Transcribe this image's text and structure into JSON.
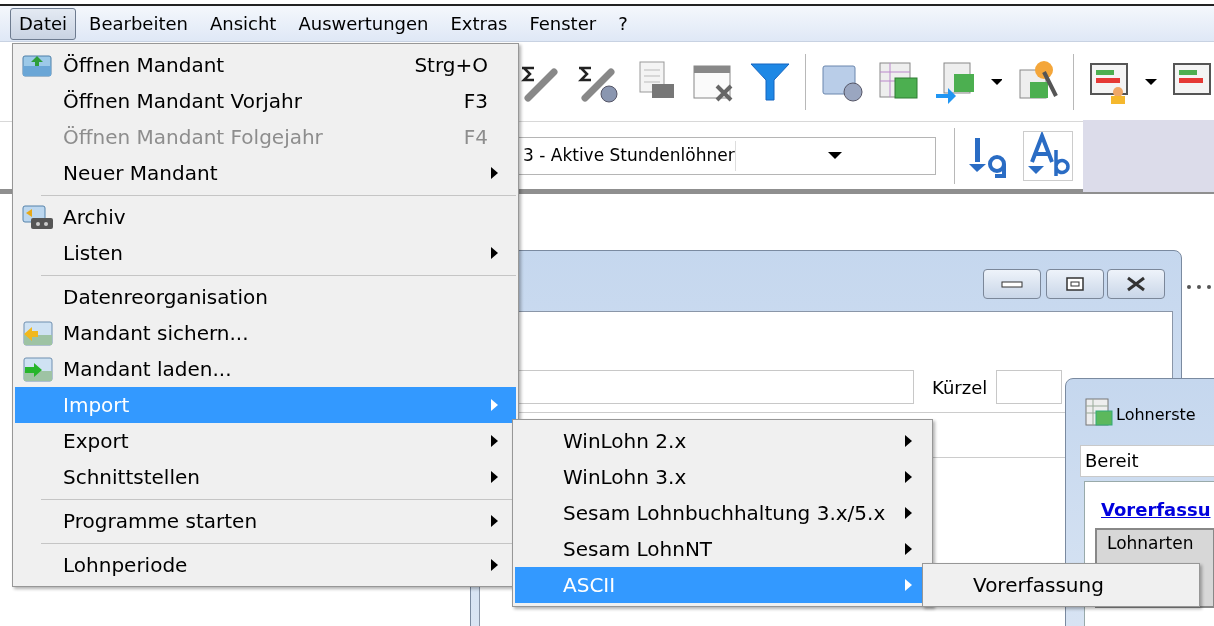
{
  "menubar": [
    {
      "label": "Datei",
      "selected": true
    },
    {
      "label": "Bearbeiten",
      "selected": false
    },
    {
      "label": "Ansicht",
      "selected": false
    },
    {
      "label": "Auswertungen",
      "selected": false
    },
    {
      "label": "Extras",
      "selected": false
    },
    {
      "label": "Fenster",
      "selected": false
    },
    {
      "label": "?",
      "selected": false
    }
  ],
  "file_menu": [
    {
      "kind": "item",
      "label": "Öffnen Mandant",
      "shortcut": "Strg+O",
      "disabled": false,
      "submenu": false,
      "selected": false
    },
    {
      "kind": "item",
      "label": "Öffnen Mandant Vorjahr",
      "shortcut": "F3",
      "disabled": false,
      "submenu": false,
      "selected": false
    },
    {
      "kind": "item",
      "label": "Öffnen Mandant Folgejahr",
      "shortcut": "F4",
      "disabled": true,
      "submenu": false,
      "selected": false
    },
    {
      "kind": "item",
      "label": "Neuer Mandant",
      "disabled": false,
      "submenu": true,
      "selected": false
    },
    {
      "kind": "separator"
    },
    {
      "kind": "item",
      "label": "Archiv",
      "disabled": false,
      "submenu": false,
      "selected": false
    },
    {
      "kind": "item",
      "label": "Listen",
      "disabled": false,
      "submenu": true,
      "selected": false
    },
    {
      "kind": "separator"
    },
    {
      "kind": "item",
      "label": "Datenreorganisation",
      "disabled": false,
      "submenu": false,
      "selected": false
    },
    {
      "kind": "item",
      "label": "Mandant sichern...",
      "disabled": false,
      "submenu": false,
      "selected": false
    },
    {
      "kind": "item",
      "label": "Mandant laden...",
      "disabled": false,
      "submenu": false,
      "selected": false
    },
    {
      "kind": "item",
      "label": "Import",
      "disabled": false,
      "submenu": true,
      "selected": true
    },
    {
      "kind": "item",
      "label": "Export",
      "disabled": false,
      "submenu": true,
      "selected": false
    },
    {
      "kind": "item",
      "label": "Schnittstellen",
      "disabled": false,
      "submenu": true,
      "selected": false
    },
    {
      "kind": "separator"
    },
    {
      "kind": "item",
      "label": "Programme starten",
      "disabled": false,
      "submenu": true,
      "selected": false
    },
    {
      "kind": "separator"
    },
    {
      "kind": "item",
      "label": "Lohnperiode",
      "disabled": false,
      "submenu": true,
      "selected": false
    }
  ],
  "import_menu": [
    {
      "kind": "item",
      "label": "WinLohn 2.x",
      "disabled": false,
      "submenu": true,
      "selected": false
    },
    {
      "kind": "item",
      "label": "WinLohn 3.x",
      "disabled": false,
      "submenu": true,
      "selected": false
    },
    {
      "kind": "item",
      "label": "Sesam Lohnbuchhaltung 3.x/5.x",
      "disabled": false,
      "submenu": true,
      "selected": false
    },
    {
      "kind": "item",
      "label": "Sesam LohnNT",
      "disabled": false,
      "submenu": true,
      "selected": false
    },
    {
      "kind": "item",
      "label": "ASCII",
      "disabled": false,
      "submenu": true,
      "selected": true
    }
  ],
  "ascii_menu": [
    {
      "kind": "item",
      "label": "Vorerfassung",
      "disabled": false,
      "submenu": false,
      "selected": false
    }
  ],
  "toolbar": {
    "filter_combo": {
      "value": "3 - Aktive Stundenlöhner"
    }
  },
  "window_1": {
    "field_label": "Kürzel"
  },
  "window_2": {
    "title": "Lohnerste",
    "status": "Bereit",
    "heading": "Vorerfassu",
    "tab": "Lohnarten"
  }
}
